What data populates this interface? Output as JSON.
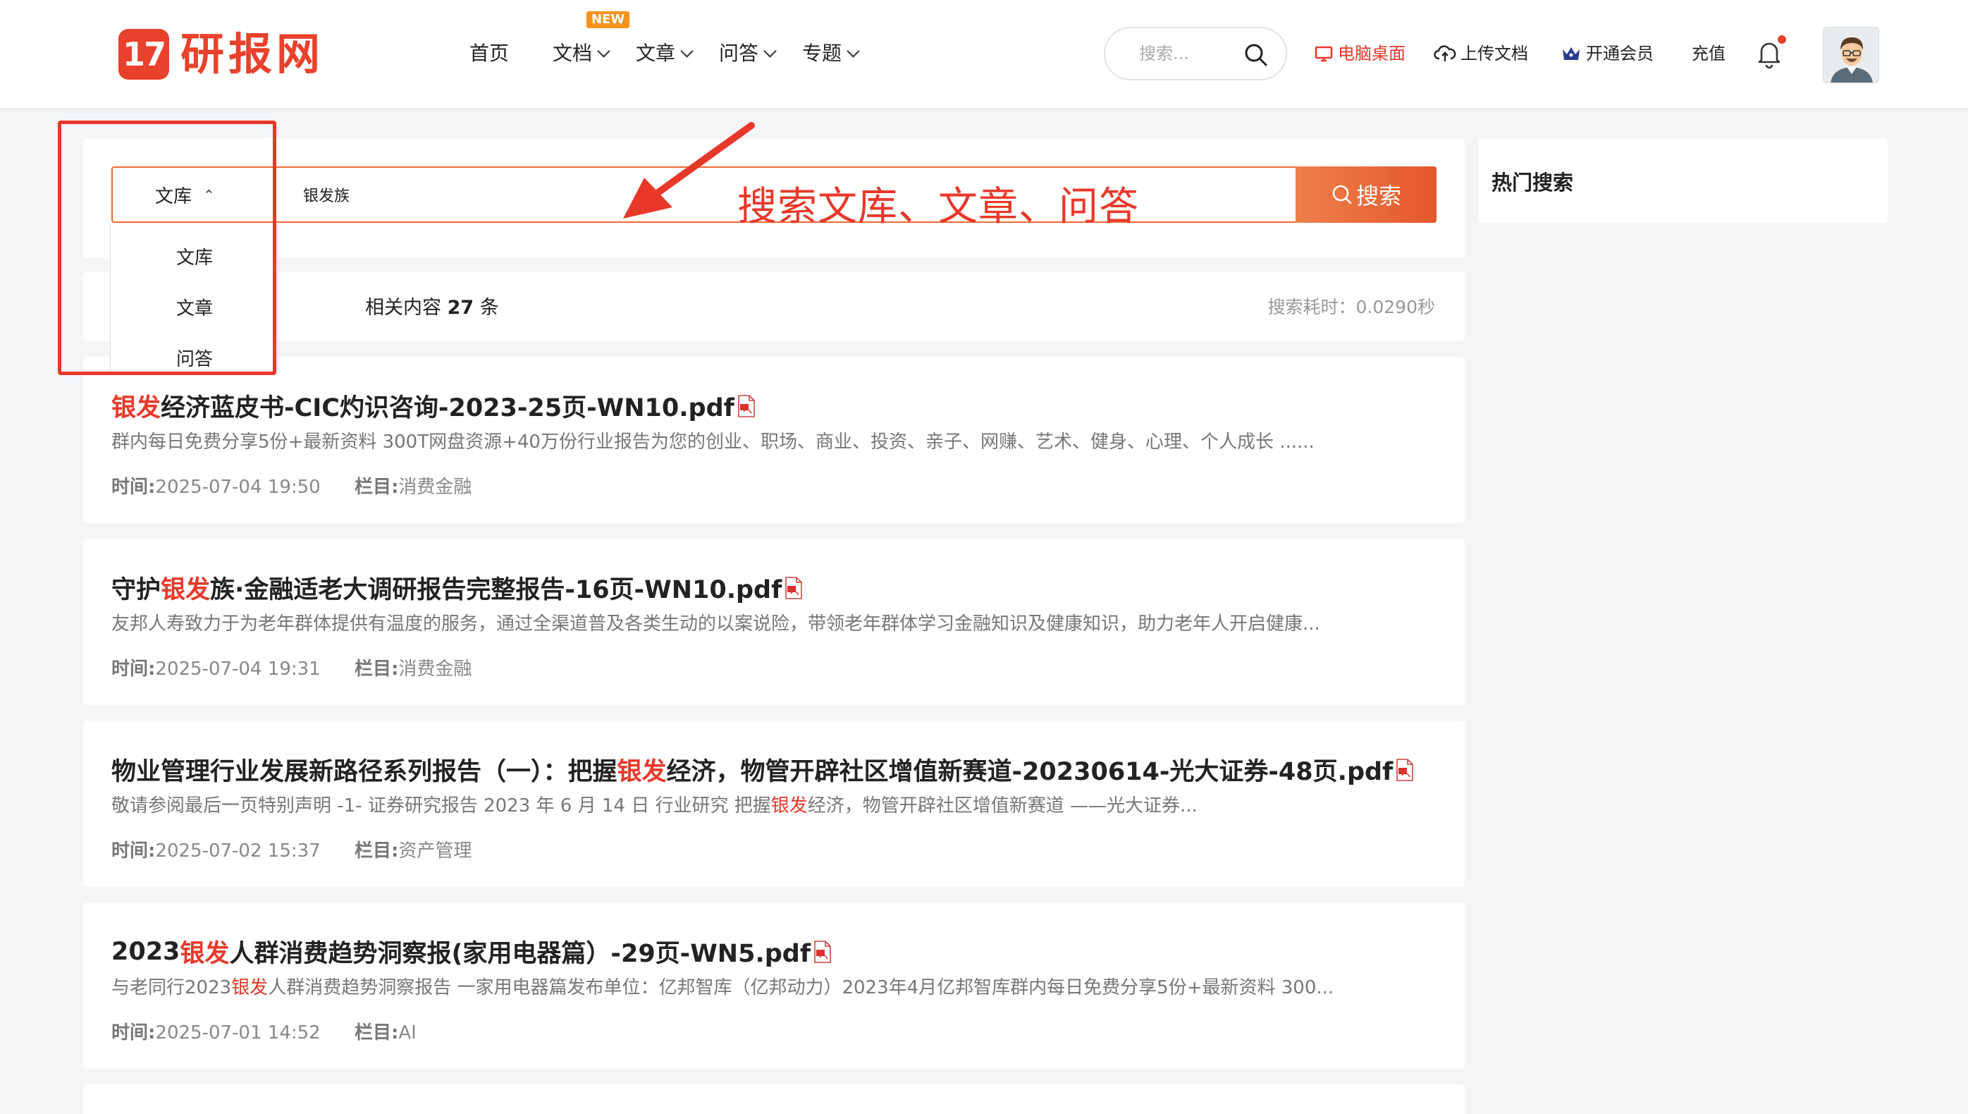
{
  "header": {
    "logo_badge": "17",
    "logo_text": "研报网",
    "nav": [
      {
        "label": "首页"
      },
      {
        "label": "文档",
        "badge": "NEW"
      },
      {
        "label": "文章"
      },
      {
        "label": "问答"
      },
      {
        "label": "专题"
      }
    ],
    "search_placeholder": "搜索...",
    "desktop_link": "电脑桌面",
    "upload_link": "上传文档",
    "vip_link": "开通会员",
    "recharge_link": "充值",
    "icons": [
      "search-icon",
      "monitor-icon",
      "cloud-upload-icon",
      "crown-icon",
      "bell-icon",
      "avatar"
    ]
  },
  "search": {
    "type_selected": "文库",
    "query": "银发族",
    "button_label": "搜索",
    "options": [
      "文库",
      "文章",
      "问答"
    ]
  },
  "annotation": {
    "text": "搜索文库、文章、问答",
    "color": "#e8382a"
  },
  "results_info": {
    "count_prefix": "相关内容",
    "count": "27",
    "count_suffix": "条",
    "timing": "搜索耗时：0.0290秒"
  },
  "results": [
    {
      "title_pre": "",
      "title_hl": "银发",
      "title_post": "经济蓝皮书-CIC灼识咨询-2023-25页-WN10.pdf",
      "desc_pre": "群内每日免费分享5份+最新资料 300T网盘资源+40万份行业报告为您的创业、职场、商业、投资、亲子、网赚、艺术、健身、心理、个人成长 ......",
      "desc_hl": "",
      "desc_post": "",
      "time_label": "时间:",
      "time": "2025-07-04 19:50",
      "column_label": "栏目:",
      "column": "消费金融"
    },
    {
      "title_pre": "守护",
      "title_hl": "银发",
      "title_post": "族·金融适老大调研报告完整报告-16页-WN10.pdf",
      "desc_pre": "友邦人寿致力于为老年群体提供有温度的服务，通过全渠道普及各类生动的以案说险，带领老年群体学习金融知识及健康知识，助力老年人开启健康...",
      "desc_hl": "",
      "desc_post": "",
      "time_label": "时间:",
      "time": "2025-07-04 19:31",
      "column_label": "栏目:",
      "column": "消费金融"
    },
    {
      "title_pre": "物业管理行业发展新路径系列报告（一）：把握",
      "title_hl": "银发",
      "title_post": "经济，物管开辟社区增值新赛道-20230614-光大证券-48页.pdf",
      "desc_pre": "敬请参阅最后一页特别声明 -1- 证券研究报告 2023 年 6 月 14 日 行业研究 把握",
      "desc_hl": "银发",
      "desc_post": "经济，物管开辟社区增值新赛道 ——光大证券...",
      "time_label": "时间:",
      "time": "2025-07-02 15:37",
      "column_label": "栏目:",
      "column": "资产管理"
    },
    {
      "title_pre": "2023",
      "title_hl": "银发",
      "title_post": "人群消费趋势洞察报(家用电器篇）-29页-WN5.pdf",
      "desc_pre": "与老同行2023",
      "desc_hl": "银发",
      "desc_post": "人群消费趋势洞察报告 一家用电器篇发布单位：亿邦智库（亿邦动力）2023年4月亿邦智库群内每日免费分享5份+最新资料 300...",
      "time_label": "时间:",
      "time": "2025-07-01 14:52",
      "column_label": "栏目:",
      "column": "AI"
    }
  ],
  "sidebar": {
    "hot_title": "热门搜索"
  }
}
